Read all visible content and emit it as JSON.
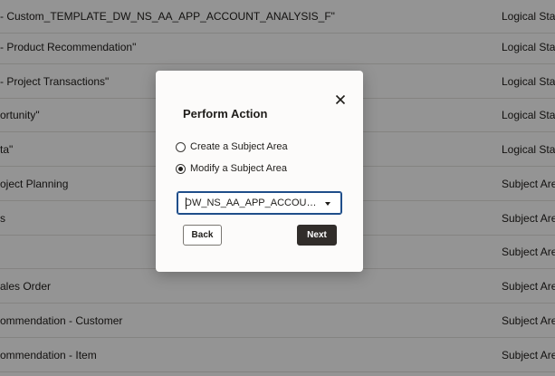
{
  "list": {
    "rows": [
      {
        "name": "- Custom_TEMPLATE_DW_NS_AA_APP_ACCOUNT_ANALYSIS_F\"",
        "type": "Logical Star"
      },
      {
        "name": "- Product Recommendation\"",
        "type": "Logical Star"
      },
      {
        "name": "- Project Transactions\"",
        "type": "Logical Star"
      },
      {
        "name": "ortunity\"",
        "type": "Logical Star"
      },
      {
        "name": "ta\"",
        "type": "Logical Star"
      },
      {
        "name": "oject Planning",
        "type": "Subject Area"
      },
      {
        "name": "s",
        "type": "Subject Area"
      },
      {
        "name": "",
        "type": "Subject Area"
      },
      {
        "name": "ales Order",
        "type": "Subject Area"
      },
      {
        "name": "ommendation - Customer",
        "type": "Subject Area"
      },
      {
        "name": "ommendation - Item",
        "type": "Subject Area"
      }
    ]
  },
  "dialog": {
    "title": "Perform Action",
    "close_icon": "close-icon",
    "options": [
      {
        "label": "Create a Subject Area",
        "selected": false
      },
      {
        "label": "Modify a Subject Area",
        "selected": true
      }
    ],
    "select": {
      "value": "DW_NS_AA_APP_ACCOUNT_ANALYSIS_F",
      "arrow_icon": "chevron-down-icon"
    },
    "back_label": "Back",
    "next_label": "Next"
  },
  "colors": {
    "primary_button": "#312d2a",
    "focus_border": "#1f4e8a"
  }
}
